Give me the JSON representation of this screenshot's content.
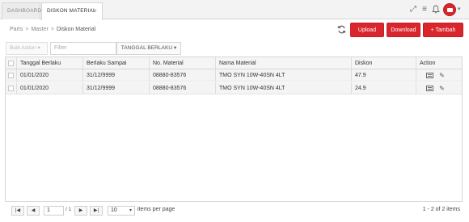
{
  "tabs": [
    {
      "label": "DASHBOARD"
    },
    {
      "label": "DISKON MATERIAL",
      "close": "×"
    }
  ],
  "topbar_icons": [
    "expand-icon",
    "menu-lines-icon",
    "bell-icon",
    "user-avatar"
  ],
  "breadcrumb": {
    "parts": "Parts",
    "master": "Master",
    "current": "Diskon Material",
    "separator": ">"
  },
  "actions": {
    "upload": "Upload",
    "download": "Download",
    "tambah": "+ Tambah"
  },
  "toolbar": {
    "bulk_action": "Bulk Action ▾",
    "filter_placeholder": "Filter",
    "date_filter": "TANGGAL BERLAKU ▾"
  },
  "table": {
    "columns": [
      "Tanggal Berlaku",
      "Berlaku Sampai",
      "No. Material",
      "Nama Material",
      "Diskon",
      "Action"
    ],
    "rows": [
      {
        "tanggal_berlaku": "01/01/2020",
        "berlaku_sampai": "31/12/9999",
        "no_material": "08880-83576",
        "nama_material": "TMO SYN 10W-40SN 4LT",
        "diskon": "47.9"
      },
      {
        "tanggal_berlaku": "01/01/2020",
        "berlaku_sampai": "31/12/9999",
        "no_material": "08880-83576",
        "nama_material": "TMO SYN 10W-40SN 4LT",
        "diskon": "24.9"
      }
    ]
  },
  "pager": {
    "first": "|◀",
    "prev": "◀",
    "page": "1",
    "of": "/ 1",
    "next": "▶",
    "last": "▶|",
    "page_size": "10",
    "page_size_caret": "▾",
    "per_page_label": "items per page",
    "info": "1 - 2 of 2 items"
  },
  "colors": {
    "accent": "#d9262c",
    "header_bg": "#f3f3f3",
    "row_bg": "#f4f4f4"
  }
}
